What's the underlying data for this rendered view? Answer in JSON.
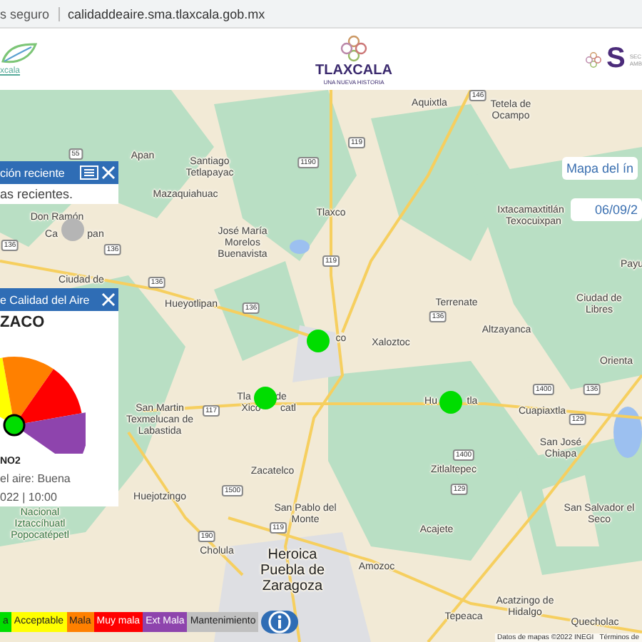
{
  "browser": {
    "security": "s seguro",
    "url": "calidaddeaire.sma.tlaxcala.gob.mx"
  },
  "header": {
    "left_logo_text": "xcala",
    "center_title": "TLAXCALA",
    "center_subtitle": "UNA NUEVA HISTORIA",
    "right_logo_letter": "S",
    "right_logo_lines": [
      "SEC",
      "AMB"
    ]
  },
  "map": {
    "places": [
      {
        "text": "Aquixtla",
        "kind": "town"
      },
      {
        "text": "Tetela de Ocampo",
        "kind": "town"
      },
      {
        "text": "Apan",
        "kind": "town"
      },
      {
        "text": "Santiago Tetlapayac",
        "kind": "town"
      },
      {
        "text": "Mazaquiahuac",
        "kind": "town"
      },
      {
        "text": "Tlaxco",
        "kind": "town"
      },
      {
        "text": "José María Morelos Buenavista",
        "kind": "town"
      },
      {
        "text": "Ixtacamaxtitlán",
        "kind": "town"
      },
      {
        "text": "Texocuixpan",
        "kind": "town"
      },
      {
        "text": "Don Ramón",
        "kind": "town"
      },
      {
        "text": "Ca",
        "kind": "town"
      },
      {
        "text": "pan",
        "kind": "town"
      },
      {
        "text": "Payu",
        "kind": "town"
      },
      {
        "text": "Hueyotlipan",
        "kind": "town"
      },
      {
        "text": "Terrenate",
        "kind": "town"
      },
      {
        "text": "Ciudad de Libres",
        "kind": "town"
      },
      {
        "text": "Altzayanca",
        "kind": "town"
      },
      {
        "text": "co",
        "kind": "town"
      },
      {
        "text": "Xaloztoc",
        "kind": "town"
      },
      {
        "text": "Orienta",
        "kind": "town"
      },
      {
        "text": "Ciudad de",
        "kind": "town"
      },
      {
        "text": "San Martin Texmelucan de Labastida",
        "kind": "town"
      },
      {
        "text": "Tla",
        "kind": "town"
      },
      {
        "text": "de",
        "kind": "town"
      },
      {
        "text": "Xico",
        "kind": "town"
      },
      {
        "text": "catl",
        "kind": "town"
      },
      {
        "text": "Hu",
        "kind": "town"
      },
      {
        "text": "tla",
        "kind": "town"
      },
      {
        "text": "Cuapiaxtla",
        "kind": "town"
      },
      {
        "text": "San José Chiapa",
        "kind": "town"
      },
      {
        "text": "Zitlaltepec",
        "kind": "town"
      },
      {
        "text": "Zacatelco",
        "kind": "town"
      },
      {
        "text": "Huejotzingo",
        "kind": "town"
      },
      {
        "text": "San Pablo del Monte",
        "kind": "town"
      },
      {
        "text": "Acajete",
        "kind": "town"
      },
      {
        "text": "San Salvador el Seco",
        "kind": "town"
      },
      {
        "text": "Cholula",
        "kind": "town"
      },
      {
        "text": "Heroica Puebla de Zaragoza",
        "kind": "city"
      },
      {
        "text": "Amozoc",
        "kind": "town"
      },
      {
        "text": "Tepeaca",
        "kind": "town"
      },
      {
        "text": "Acatzingo de Hidalgo",
        "kind": "town"
      },
      {
        "text": "Quecholac",
        "kind": "town"
      },
      {
        "text": "Nacional Iztaccíhuatl Popocatépetl",
        "kind": "park"
      }
    ],
    "shields": [
      "55",
      "136",
      "136",
      "136",
      "1190",
      "119",
      "119",
      "136",
      "136",
      "146",
      "117",
      "1400",
      "136",
      "129",
      "1400",
      "129",
      "1500",
      "119",
      "190"
    ],
    "stations": [
      {
        "color": "#00dd00"
      },
      {
        "color": "#00dd00"
      },
      {
        "color": "#00dd00"
      },
      {
        "color": "#b5b5b5"
      }
    ],
    "attribution": "Datos de mapas ©2022 INEGI   Términos de"
  },
  "recent_panel": {
    "title": "ción reciente",
    "body": "as recientes."
  },
  "quality_panel": {
    "title": "e Calidad del Aire",
    "station": "ZACO",
    "pollutant": "NO2",
    "status": "el aire: Buena",
    "datetime": "022 | 10:00"
  },
  "index_box": {
    "title": "Mapa del ín",
    "date": "06/09/2"
  },
  "legend": [
    {
      "label": "a",
      "color": "#00dd00"
    },
    {
      "label": "Acceptable",
      "color": "#ffff00"
    },
    {
      "label": "Mala",
      "color": "#ff8000"
    },
    {
      "label": "Muy mala",
      "color": "#ff0000"
    },
    {
      "label": "Ext Mala",
      "color": "#8e44ad"
    },
    {
      "label": "Mantenimiento",
      "color": "#c0c0c0"
    }
  ]
}
